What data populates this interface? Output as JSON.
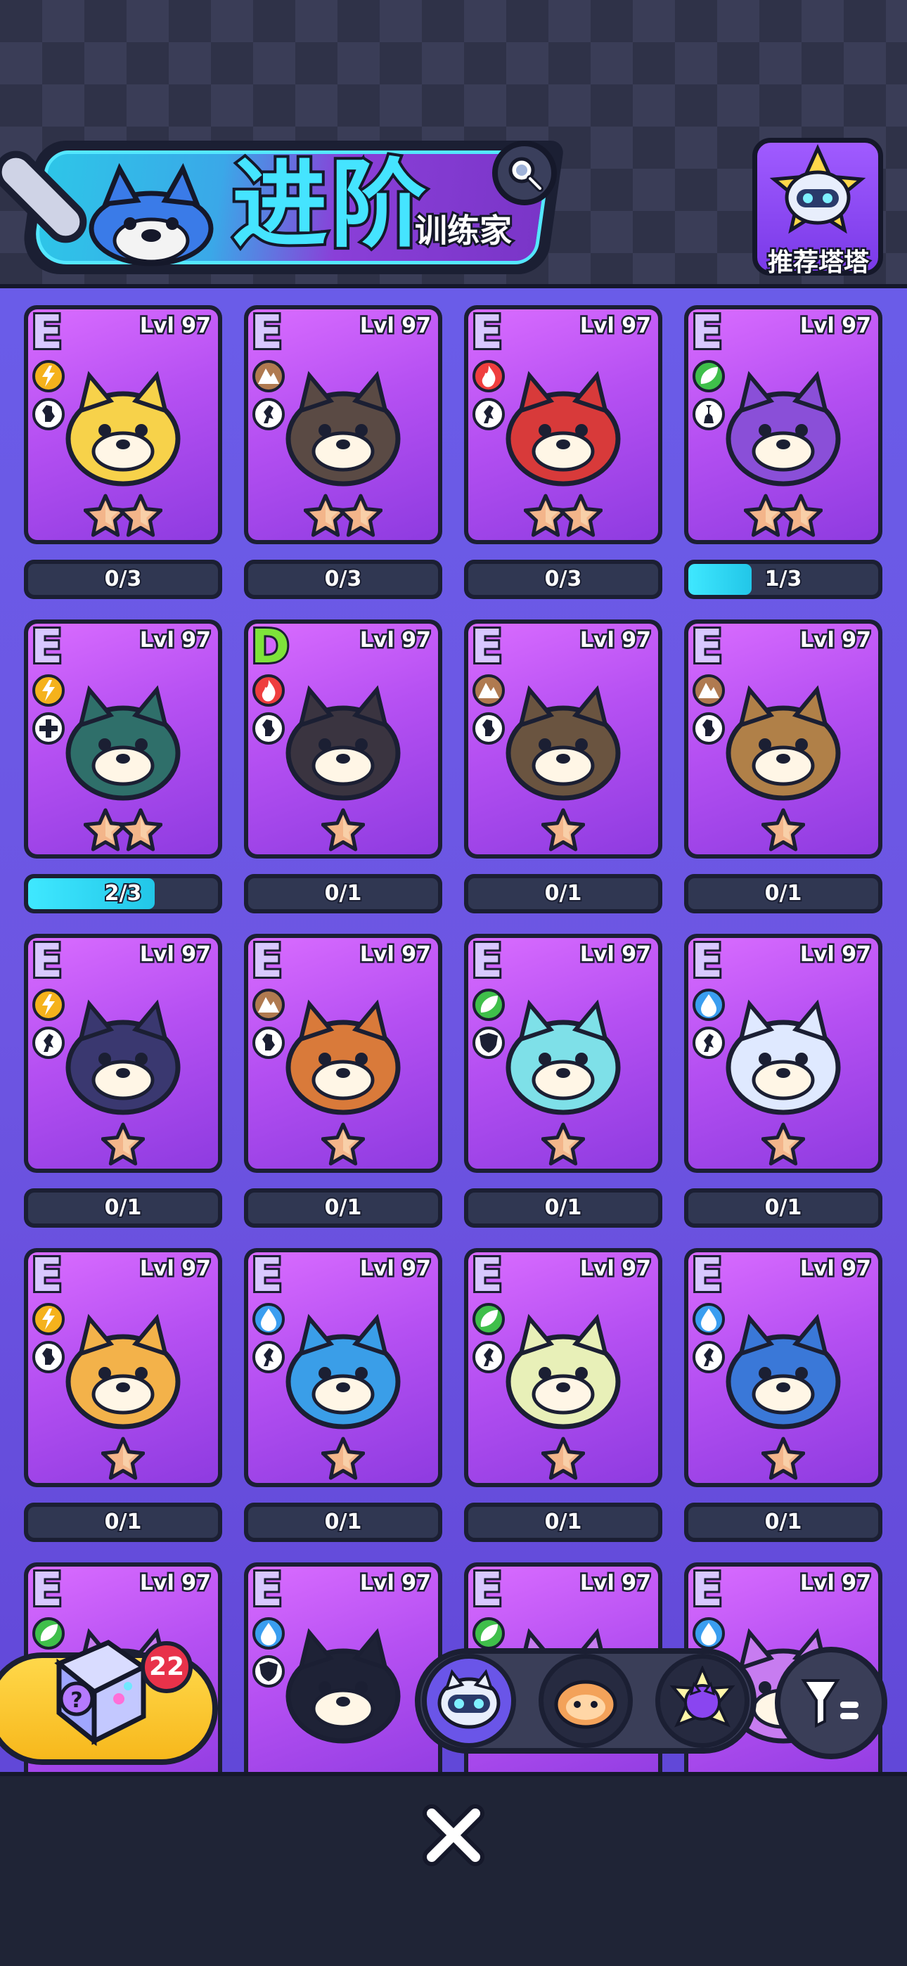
{
  "header": {
    "title_main": "进阶",
    "title_sub": "训练家",
    "recommend_label": "推荐塔塔"
  },
  "colors": {
    "grade_E": "#d8c8ff",
    "grade_D": "#7ee33a",
    "electric": "#f5b21c",
    "ground": "#b07a50",
    "fire": "#ef3e3e",
    "grass": "#3fbf4a",
    "water": "#3a9ef0",
    "progress_fill": "#3fe8ff"
  },
  "cards": [
    {
      "grade": "E",
      "level": "Lvl 97",
      "element": "electric",
      "role": "assassin",
      "stars": 2,
      "progress": "0/3",
      "fill": 0,
      "creature": "fox"
    },
    {
      "grade": "E",
      "level": "Lvl 97",
      "element": "ground",
      "role": "fighter",
      "stars": 2,
      "progress": "0/3",
      "fill": 0,
      "creature": "mole"
    },
    {
      "grade": "E",
      "level": "Lvl 97",
      "element": "fire",
      "role": "fighter",
      "stars": 2,
      "progress": "0/3",
      "fill": 0,
      "creature": "bird"
    },
    {
      "grade": "E",
      "level": "Lvl 97",
      "element": "grass",
      "role": "mage",
      "stars": 2,
      "progress": "1/3",
      "fill": 0.333,
      "creature": "mushroom"
    },
    {
      "grade": "E",
      "level": "Lvl 97",
      "element": "electric",
      "role": "healer",
      "stars": 2,
      "progress": "2/3",
      "fill": 0.667,
      "creature": "peacock"
    },
    {
      "grade": "D",
      "level": "Lvl 97",
      "element": "fire",
      "role": "assassin",
      "stars": 1,
      "progress": "0/1",
      "fill": 0,
      "creature": "dog"
    },
    {
      "grade": "E",
      "level": "Lvl 97",
      "element": "ground",
      "role": "assassin",
      "stars": 1,
      "progress": "0/1",
      "fill": 0,
      "creature": "lizard"
    },
    {
      "grade": "E",
      "level": "Lvl 97",
      "element": "ground",
      "role": "assassin",
      "stars": 1,
      "progress": "0/1",
      "fill": 0,
      "creature": "turtle"
    },
    {
      "grade": "E",
      "level": "Lvl 97",
      "element": "electric",
      "role": "fighter",
      "stars": 1,
      "progress": "0/1",
      "fill": 0,
      "creature": "boar"
    },
    {
      "grade": "E",
      "level": "Lvl 97",
      "element": "ground",
      "role": "assassin",
      "stars": 1,
      "progress": "0/1",
      "fill": 0,
      "creature": "kangaroo"
    },
    {
      "grade": "E",
      "level": "Lvl 97",
      "element": "grass",
      "role": "tank",
      "stars": 1,
      "progress": "0/1",
      "fill": 0,
      "creature": "frog"
    },
    {
      "grade": "E",
      "level": "Lvl 97",
      "element": "water",
      "role": "fighter",
      "stars": 1,
      "progress": "0/1",
      "fill": 0,
      "creature": "jellyfish"
    },
    {
      "grade": "E",
      "level": "Lvl 97",
      "element": "electric",
      "role": "assassin",
      "stars": 1,
      "progress": "0/1",
      "fill": 0,
      "creature": "raccoon"
    },
    {
      "grade": "E",
      "level": "Lvl 97",
      "element": "water",
      "role": "fighter",
      "stars": 1,
      "progress": "0/1",
      "fill": 0,
      "creature": "octopus"
    },
    {
      "grade": "E",
      "level": "Lvl 97",
      "element": "grass",
      "role": "fighter",
      "stars": 1,
      "progress": "0/1",
      "fill": 0,
      "creature": "chicken"
    },
    {
      "grade": "E",
      "level": "Lvl 97",
      "element": "water",
      "role": "fighter",
      "stars": 1,
      "progress": "0/1",
      "fill": 0,
      "creature": "seal"
    },
    {
      "grade": "E",
      "level": "Lvl 97",
      "element": "grass",
      "role": "none",
      "stars": 0,
      "progress": "",
      "fill": 0,
      "creature": "hidden"
    },
    {
      "grade": "E",
      "level": "Lvl 97",
      "element": "water",
      "role": "tank",
      "stars": 0,
      "progress": "",
      "fill": 0,
      "creature": "penguin"
    },
    {
      "grade": "E",
      "level": "Lvl 97",
      "element": "grass",
      "role": "none",
      "stars": 0,
      "progress": "",
      "fill": 0,
      "creature": "hidden"
    },
    {
      "grade": "E",
      "level": "Lvl 97",
      "element": "water",
      "role": "none",
      "stars": 0,
      "progress": "",
      "fill": 0,
      "creature": "hidden"
    }
  ],
  "gift": {
    "count": "22"
  },
  "filter_tabs": [
    {
      "name": "tab-robot",
      "active": true
    },
    {
      "name": "tab-bread",
      "active": false
    },
    {
      "name": "tab-cat-gem",
      "active": false
    }
  ]
}
